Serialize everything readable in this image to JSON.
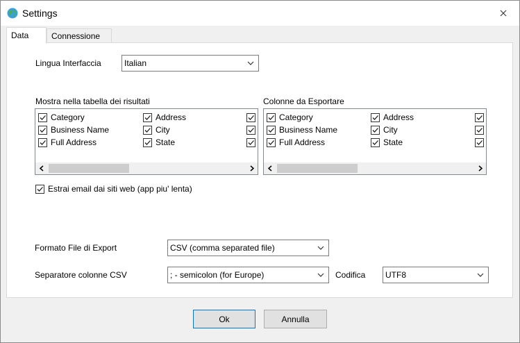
{
  "window": {
    "title": "Settings"
  },
  "tabs": [
    {
      "label": "Data",
      "active": true
    },
    {
      "label": "Connessione",
      "active": false
    }
  ],
  "data_tab": {
    "language_label": "Lingua Interfaccia",
    "language_value": "Italian",
    "results_group_label": "Mostra nella tabella dei risultati",
    "export_group_label": "Colonne da Esportare",
    "results_columns": [
      {
        "label": "Category",
        "checked": true
      },
      {
        "label": "Address",
        "checked": true
      },
      {
        "label": "",
        "checked": true
      },
      {
        "label": "Business Name",
        "checked": true
      },
      {
        "label": "City",
        "checked": true
      },
      {
        "label": "",
        "checked": true
      },
      {
        "label": "Full Address",
        "checked": true
      },
      {
        "label": "State",
        "checked": true
      },
      {
        "label": "",
        "checked": true
      }
    ],
    "export_columns": [
      {
        "label": "Category",
        "checked": true
      },
      {
        "label": "Address",
        "checked": true
      },
      {
        "label": "",
        "checked": true
      },
      {
        "label": "Business Name",
        "checked": true
      },
      {
        "label": "City",
        "checked": true
      },
      {
        "label": "",
        "checked": true
      },
      {
        "label": "Full Address",
        "checked": true
      },
      {
        "label": "State",
        "checked": true
      },
      {
        "label": "",
        "checked": true
      }
    ],
    "extract_email_label": "Estrai email dai siti web (app piu' lenta)",
    "extract_email_checked": true,
    "export_format_label": "Formato File di Export",
    "export_format_value": "CSV (comma separated file)",
    "csv_separator_label": "Separatore colonne CSV",
    "csv_separator_value": "; - semicolon (for Europe)",
    "encoding_label": "Codifica",
    "encoding_value": "UTF8"
  },
  "buttons": {
    "ok": "Ok",
    "cancel": "Annulla"
  },
  "colors": {
    "accent": "#0078d7",
    "window_bg": "#f0f0f0",
    "panel_bg": "#ffffff"
  }
}
